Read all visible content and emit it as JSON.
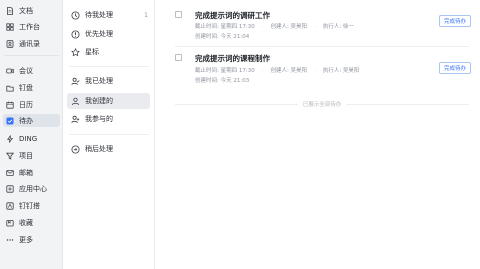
{
  "nav": {
    "items": [
      {
        "label": "文档",
        "icon": "document-icon"
      },
      {
        "label": "工作台",
        "icon": "workspace-icon"
      },
      {
        "label": "通讯录",
        "icon": "contacts-icon"
      },
      {
        "label": "会议",
        "icon": "meeting-icon"
      },
      {
        "label": "钉盘",
        "icon": "drive-icon"
      },
      {
        "label": "日历",
        "icon": "calendar-icon"
      },
      {
        "label": "待办",
        "icon": "todo-icon"
      },
      {
        "label": "DING",
        "icon": "ding-icon"
      },
      {
        "label": "项目",
        "icon": "project-icon"
      },
      {
        "label": "邮箱",
        "icon": "mail-icon"
      },
      {
        "label": "应用中心",
        "icon": "app-center-icon"
      },
      {
        "label": "钉钉搭",
        "icon": "builder-icon"
      },
      {
        "label": "收藏",
        "icon": "favorites-icon"
      },
      {
        "label": "更多",
        "icon": "more-icon"
      }
    ],
    "active_index": 6
  },
  "sub": {
    "items": [
      {
        "label": "待我处理",
        "icon": "clock-icon",
        "count": "1"
      },
      {
        "label": "优先处理",
        "icon": "priority-icon",
        "count": ""
      },
      {
        "label": "星标",
        "icon": "star-icon",
        "count": ""
      },
      {
        "label": "我已处理",
        "icon": "user-check-icon",
        "count": ""
      },
      {
        "label": "我创建的",
        "icon": "user-icon",
        "count": ""
      },
      {
        "label": "我参与的",
        "icon": "user-plus-icon",
        "count": ""
      },
      {
        "label": "稍后处理",
        "icon": "later-icon",
        "count": ""
      }
    ],
    "active_index": 4
  },
  "tasks": [
    {
      "title": "完成提示词的调研工作",
      "deadline": "截止时间: 星期四 17:30",
      "creator": "创建人: 吴昊阳",
      "executor": "执行人: 徐一",
      "created": "创建时间: 今天 21:04",
      "button": "完成待办"
    },
    {
      "title": "完成提示词的课程制作",
      "deadline": "截止时间: 星期四 17:30",
      "creator": "创建人: 吴昊阳",
      "executor": "执行人: 吴昊阳",
      "created": "创建时间: 今天 21:03",
      "button": "完成待办"
    }
  ],
  "end_text": "已展示全部待办"
}
